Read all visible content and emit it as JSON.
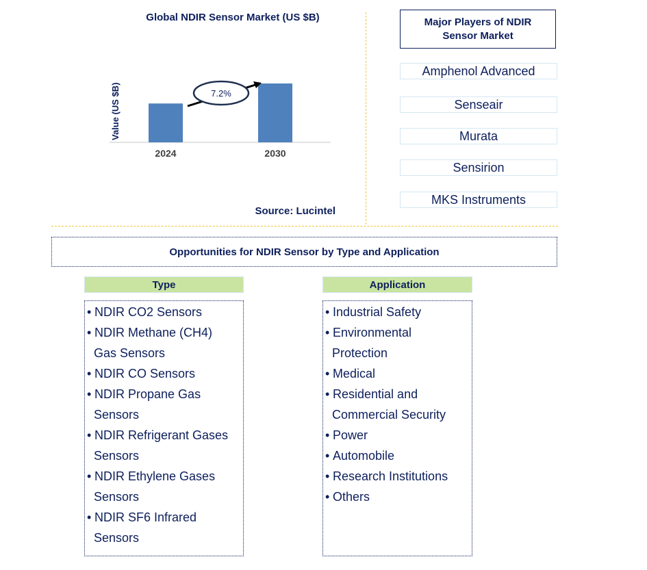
{
  "chart_data": {
    "type": "bar",
    "title": "Global NDIR Sensor Market (US $B)",
    "xlabel": "",
    "ylabel": "Value (US $B)",
    "categories": [
      "2024",
      "2030"
    ],
    "values": [
      0.66,
      1.0
    ],
    "value_note": "relative bar heights; no y-axis scale shown",
    "annotation": {
      "text": "7.2%",
      "meaning": "CAGR 2024-2030"
    },
    "grid": false,
    "bar_color": "#4f81bd"
  },
  "source": "Source: Lucintel",
  "players": {
    "header": [
      "Major Players of NDIR",
      "Sensor Market"
    ],
    "items": [
      "Amphenol Advanced",
      "Senseair",
      "Murata",
      "Sensirion",
      "MKS Instruments"
    ]
  },
  "opportunities": {
    "title": "Opportunities for NDIR Sensor by Type and Application",
    "type": {
      "header": "Type",
      "items": [
        [
          "NDIR CO2 Sensors"
        ],
        [
          "NDIR Methane (CH4)",
          "Gas Sensors"
        ],
        [
          "NDIR CO Sensors"
        ],
        [
          "NDIR Propane Gas",
          "Sensors"
        ],
        [
          "NDIR Refrigerant Gases",
          "Sensors"
        ],
        [
          "NDIR Ethylene Gases",
          "Sensors"
        ],
        [
          "NDIR SF6 Infrared",
          "Sensors"
        ]
      ]
    },
    "application": {
      "header": "Application",
      "items": [
        [
          "Industrial Safety"
        ],
        [
          "Environmental",
          "Protection"
        ],
        [
          "Medical"
        ],
        [
          "Residential and",
          "Commercial Security"
        ],
        [
          "Power"
        ],
        [
          "Automobile"
        ],
        [
          "Research Institutions"
        ],
        [
          "Others"
        ]
      ]
    }
  },
  "colors": {
    "text": "#0d1f5c",
    "bar": "#4f81bd",
    "divider": "#f4c430",
    "header_fill": "#c9e4a0"
  }
}
